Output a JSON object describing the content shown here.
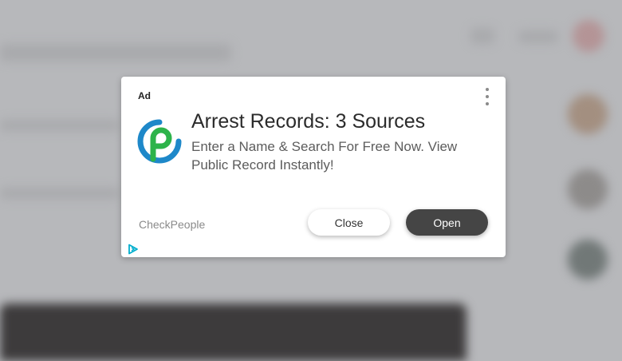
{
  "ad": {
    "label": "Ad",
    "headline": "Arrest Records: 3 Sources",
    "description": "Enter a Name & Search For Free Now. View Public Record Instantly!",
    "advertiser": "CheckPeople",
    "close_label": "Close",
    "open_label": "Open",
    "icons": {
      "menu": "more-vertical-icon",
      "logo": "checkpeople-logo",
      "adchoices": "adchoices-icon"
    }
  },
  "colors": {
    "overlay": "#b7b8bb",
    "card": "#ffffff",
    "open_button": "#454545",
    "logo_blue": "#1e88c9",
    "logo_green": "#2db34a",
    "adchoices": "#00aecd"
  }
}
